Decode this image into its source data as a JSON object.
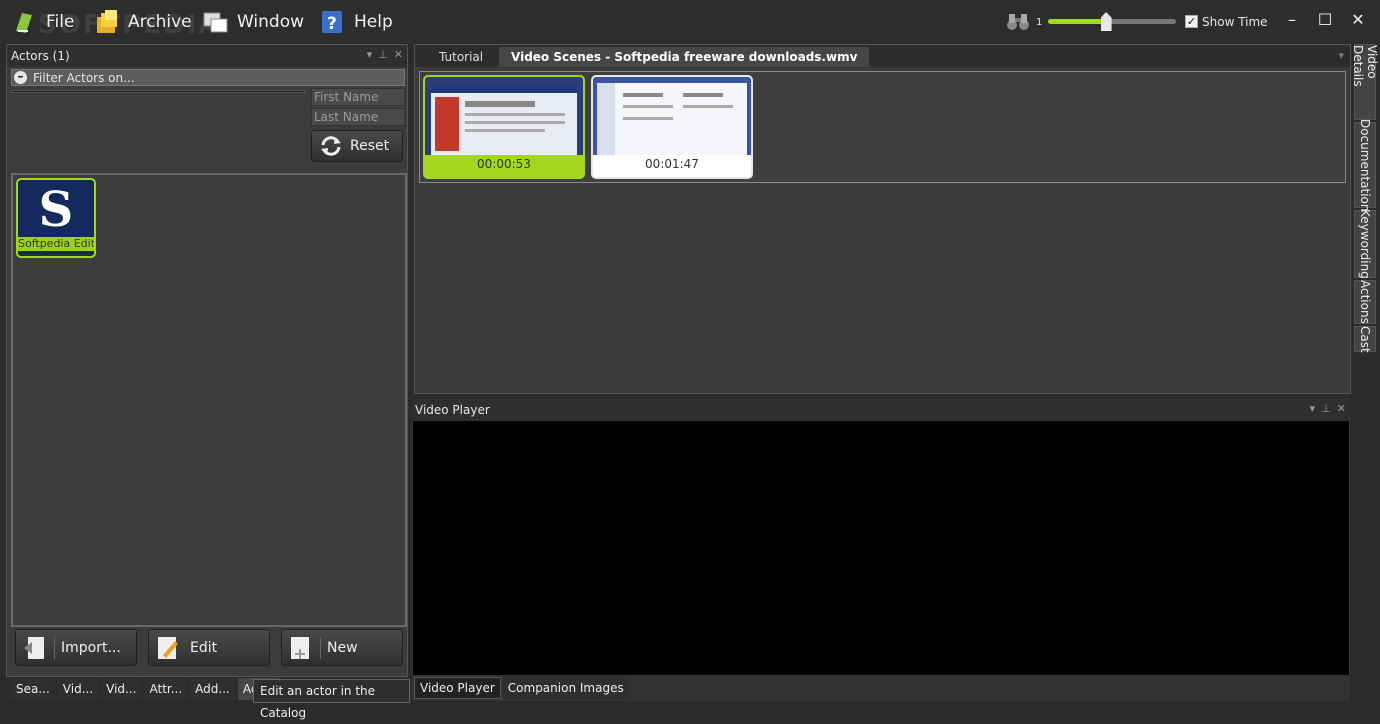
{
  "menu": {
    "file": "File",
    "archive": "Archive",
    "window": "Window",
    "help": "Help"
  },
  "watermark": "SOFTPEDIA",
  "zoom": {
    "value": "1",
    "level": 0.45
  },
  "show_time": {
    "label": "Show Time",
    "checked": true
  },
  "window_controls": {
    "minimize": "–",
    "maximize": "☐",
    "close": "✕"
  },
  "actors_panel": {
    "title": "Actors (1)",
    "filter_label": "Filter Actors on...",
    "first_name_placeholder": "First Name",
    "last_name_placeholder": "Last Name",
    "reset_label": "Reset",
    "actors": [
      {
        "initial": "S",
        "name": "Softpedia Editor"
      }
    ],
    "import_label": "Import...",
    "edit_label": "Edit",
    "new_label": "New",
    "tabs": [
      "Sea...",
      "Vid...",
      "Vid...",
      "Attr...",
      "Add...",
      "Act..."
    ],
    "tooltip": "Edit an actor in the Catalog"
  },
  "scenes_panel": {
    "tabs": [
      "Tutorial",
      "Video Scenes - Softpedia freeware downloads.wmv"
    ],
    "scenes": [
      {
        "time": "00:00:53"
      },
      {
        "time": "00:01:47"
      }
    ]
  },
  "side_tabs": [
    "Video Details",
    "Documentation",
    "Keywording",
    "Actions",
    "Cast"
  ],
  "player_panel": {
    "title": "Video Player",
    "tabs": [
      "Video Player",
      "Companion Images"
    ]
  },
  "colors": {
    "accent": "#a4d620",
    "background": "#2b2b2b",
    "panel": "#3c3c3c"
  }
}
